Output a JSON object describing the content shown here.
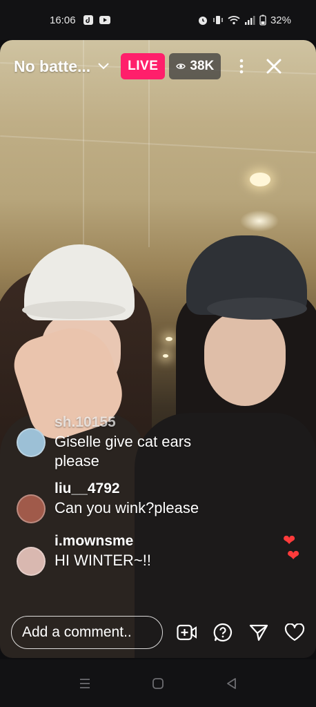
{
  "status_bar": {
    "time": "16:06",
    "battery": "32%",
    "icons": [
      "tiktok-icon",
      "youtube-icon",
      "alarm-icon",
      "vibrate-icon",
      "wifi-icon",
      "signal-icon",
      "battery-icon"
    ]
  },
  "live": {
    "title": "No batte...",
    "badge": "LIVE",
    "viewers": "38K"
  },
  "comments": [
    {
      "user": "sh.10155",
      "text": "Giselle give cat ears please",
      "avatar_color": "#9cc0d6"
    },
    {
      "user": "liu__4792",
      "text": "Can you wink?please",
      "avatar_color": "#a05a4a"
    },
    {
      "user": "i.mownsme",
      "text": "HI WINTER~!!",
      "avatar_color": "#d9b8b0"
    }
  ],
  "composer": {
    "placeholder": "Add a comment..",
    "icons": [
      "add-video-icon",
      "question-icon",
      "send-icon",
      "heart-icon"
    ]
  },
  "nav": {
    "icons": [
      "recents-icon",
      "home-icon",
      "back-icon"
    ]
  },
  "colors": {
    "live_badge": "#ff1f6b",
    "heart": "#ff3b3b"
  }
}
